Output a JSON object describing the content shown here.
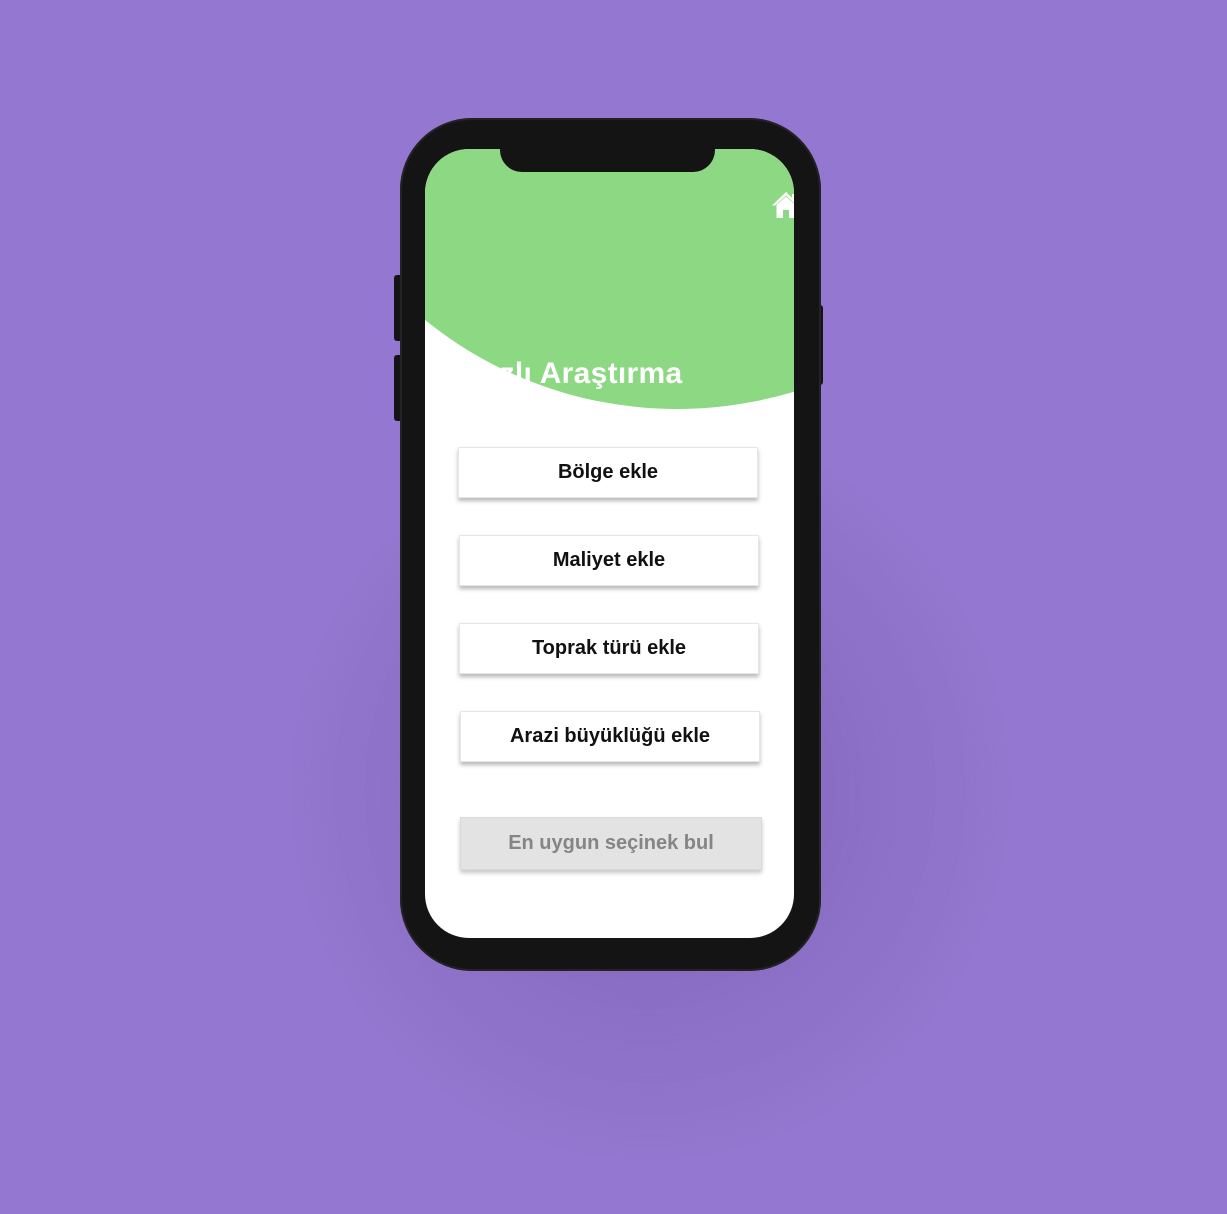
{
  "colors": {
    "background": "#9377d0",
    "phone_frame": "#141414",
    "header_accent": "#8cd883",
    "screen": "#ffffff",
    "button_text": "#111111",
    "disabled_button_bg": "#e3e3e3",
    "disabled_button_text": "#858585"
  },
  "header": {
    "title": "Hızlı Araştırma",
    "home_icon": "home-icon"
  },
  "actions": [
    {
      "label": "Bölge ekle"
    },
    {
      "label": "Maliyet ekle"
    },
    {
      "label": "Toprak türü ekle"
    },
    {
      "label": "Arazi büyüklüğü ekle"
    }
  ],
  "submit": {
    "label": "En uygun seçinek bul",
    "state": "disabled"
  }
}
